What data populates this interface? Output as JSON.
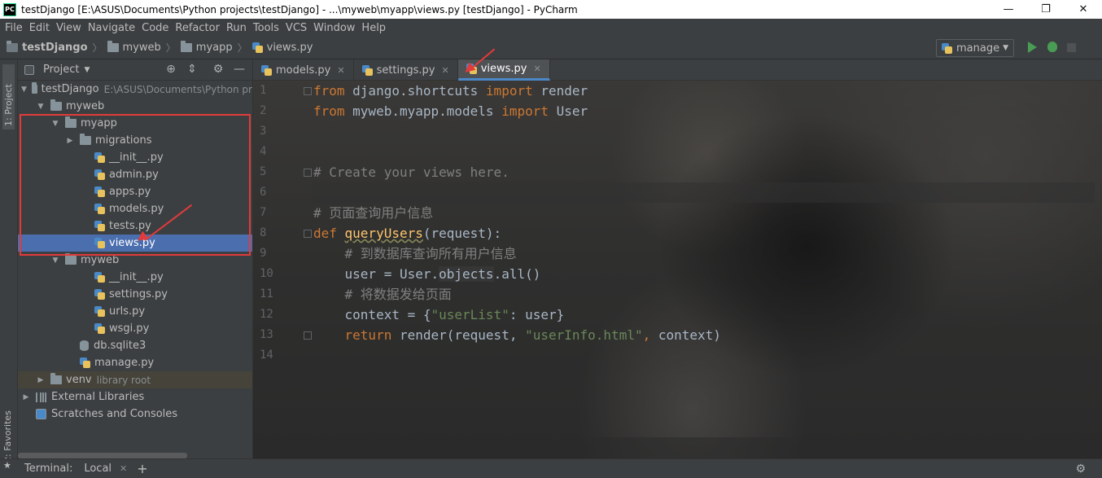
{
  "window": {
    "title": "testDjango [E:\\ASUS\\Documents\\Python projects\\testDjango] - ...\\myweb\\myapp\\views.py [testDjango] - PyCharm",
    "app_icon": "PC",
    "controls": {
      "minimize": "—",
      "restore": "❐",
      "close": "✕"
    }
  },
  "menu": [
    "File",
    "Edit",
    "View",
    "Navigate",
    "Code",
    "Refactor",
    "Run",
    "Tools",
    "VCS",
    "Window",
    "Help"
  ],
  "navbar": {
    "breadcrumbs": [
      "testDjango",
      "myweb",
      "myapp",
      "views.py"
    ],
    "run_config": "manage"
  },
  "left_stripe": {
    "project_tab": "1: Project",
    "favorites_tab": "2: Favorites"
  },
  "project_panel": {
    "title": "Project",
    "tree": [
      {
        "label": "testDjango",
        "extra": "E:\\ASUS\\Documents\\Python pr",
        "indent": 0,
        "kind": "folder",
        "toggle": "▼"
      },
      {
        "label": "myweb",
        "indent": 1,
        "kind": "folder",
        "toggle": "▼"
      },
      {
        "label": "myapp",
        "indent": 2,
        "kind": "folder",
        "toggle": "▼"
      },
      {
        "label": "migrations",
        "indent": 3,
        "kind": "folder",
        "toggle": "▶"
      },
      {
        "label": "__init__.py",
        "indent": 4,
        "kind": "py"
      },
      {
        "label": "admin.py",
        "indent": 4,
        "kind": "py"
      },
      {
        "label": "apps.py",
        "indent": 4,
        "kind": "py"
      },
      {
        "label": "models.py",
        "indent": 4,
        "kind": "py"
      },
      {
        "label": "tests.py",
        "indent": 4,
        "kind": "py"
      },
      {
        "label": "views.py",
        "indent": 4,
        "kind": "py",
        "selected": true
      },
      {
        "label": "myweb",
        "indent": 2,
        "kind": "folder",
        "toggle": "▼"
      },
      {
        "label": "__init__.py",
        "indent": 4,
        "kind": "py"
      },
      {
        "label": "settings.py",
        "indent": 4,
        "kind": "py"
      },
      {
        "label": "urls.py",
        "indent": 4,
        "kind": "py"
      },
      {
        "label": "wsgi.py",
        "indent": 4,
        "kind": "py"
      },
      {
        "label": "db.sqlite3",
        "indent": 3,
        "kind": "db"
      },
      {
        "label": "manage.py",
        "indent": 3,
        "kind": "py"
      },
      {
        "label": "venv",
        "extra": "library root",
        "indent": 1,
        "kind": "folder",
        "toggle": "▶",
        "highlight": true
      },
      {
        "label": "External Libraries",
        "indent": 0,
        "kind": "lib",
        "toggle": "▶"
      },
      {
        "label": "Scratches and Consoles",
        "indent": 0,
        "kind": "scratch"
      }
    ]
  },
  "editor": {
    "tabs": [
      {
        "label": "models.py",
        "active": false
      },
      {
        "label": "settings.py",
        "active": false
      },
      {
        "label": "views.py",
        "active": true
      }
    ],
    "current_line": 6,
    "lines": [
      [
        [
          "kw",
          "from"
        ],
        [
          "t",
          " django.shortcuts "
        ],
        [
          "kw",
          "import"
        ],
        [
          "t",
          " render"
        ]
      ],
      [
        [
          "kw",
          "from"
        ],
        [
          "t",
          " myweb.myapp.models "
        ],
        [
          "kw",
          "import"
        ],
        [
          "t",
          " User"
        ]
      ],
      [],
      [],
      [
        [
          "cm",
          "# Create your views here."
        ]
      ],
      [],
      [
        [
          "cm",
          "# 页面查询用户信息"
        ]
      ],
      [
        [
          "kw",
          "def "
        ],
        [
          "fn",
          "queryUsers"
        ],
        [
          "t",
          "(request):"
        ]
      ],
      [
        [
          "t",
          "    "
        ],
        [
          "cm",
          "# 到数据库查询所有用户信息"
        ]
      ],
      [
        [
          "t",
          "    user = User."
        ],
        [
          "mem",
          "objects"
        ],
        [
          "t",
          ".all()"
        ]
      ],
      [
        [
          "t",
          "    "
        ],
        [
          "cm",
          "# 将数据发给页面"
        ]
      ],
      [
        [
          "t",
          "    context = {"
        ],
        [
          "str",
          "\"userList\""
        ],
        [
          "t",
          ": user}"
        ]
      ],
      [
        [
          "t",
          "    "
        ],
        [
          "kw",
          "return"
        ],
        [
          "t",
          " render(request, "
        ],
        [
          "str",
          "\"userInfo.html\""
        ],
        [
          "kw",
          ","
        ],
        [
          "t",
          " context)"
        ]
      ],
      []
    ]
  },
  "bottom": {
    "terminal_label": "Terminal:",
    "session": "Local"
  },
  "colors": {
    "annotation": "#e33b3b",
    "selection": "#4b6eaf",
    "keyword": "#cc7832",
    "comment": "#808080",
    "string": "#6a8759"
  }
}
